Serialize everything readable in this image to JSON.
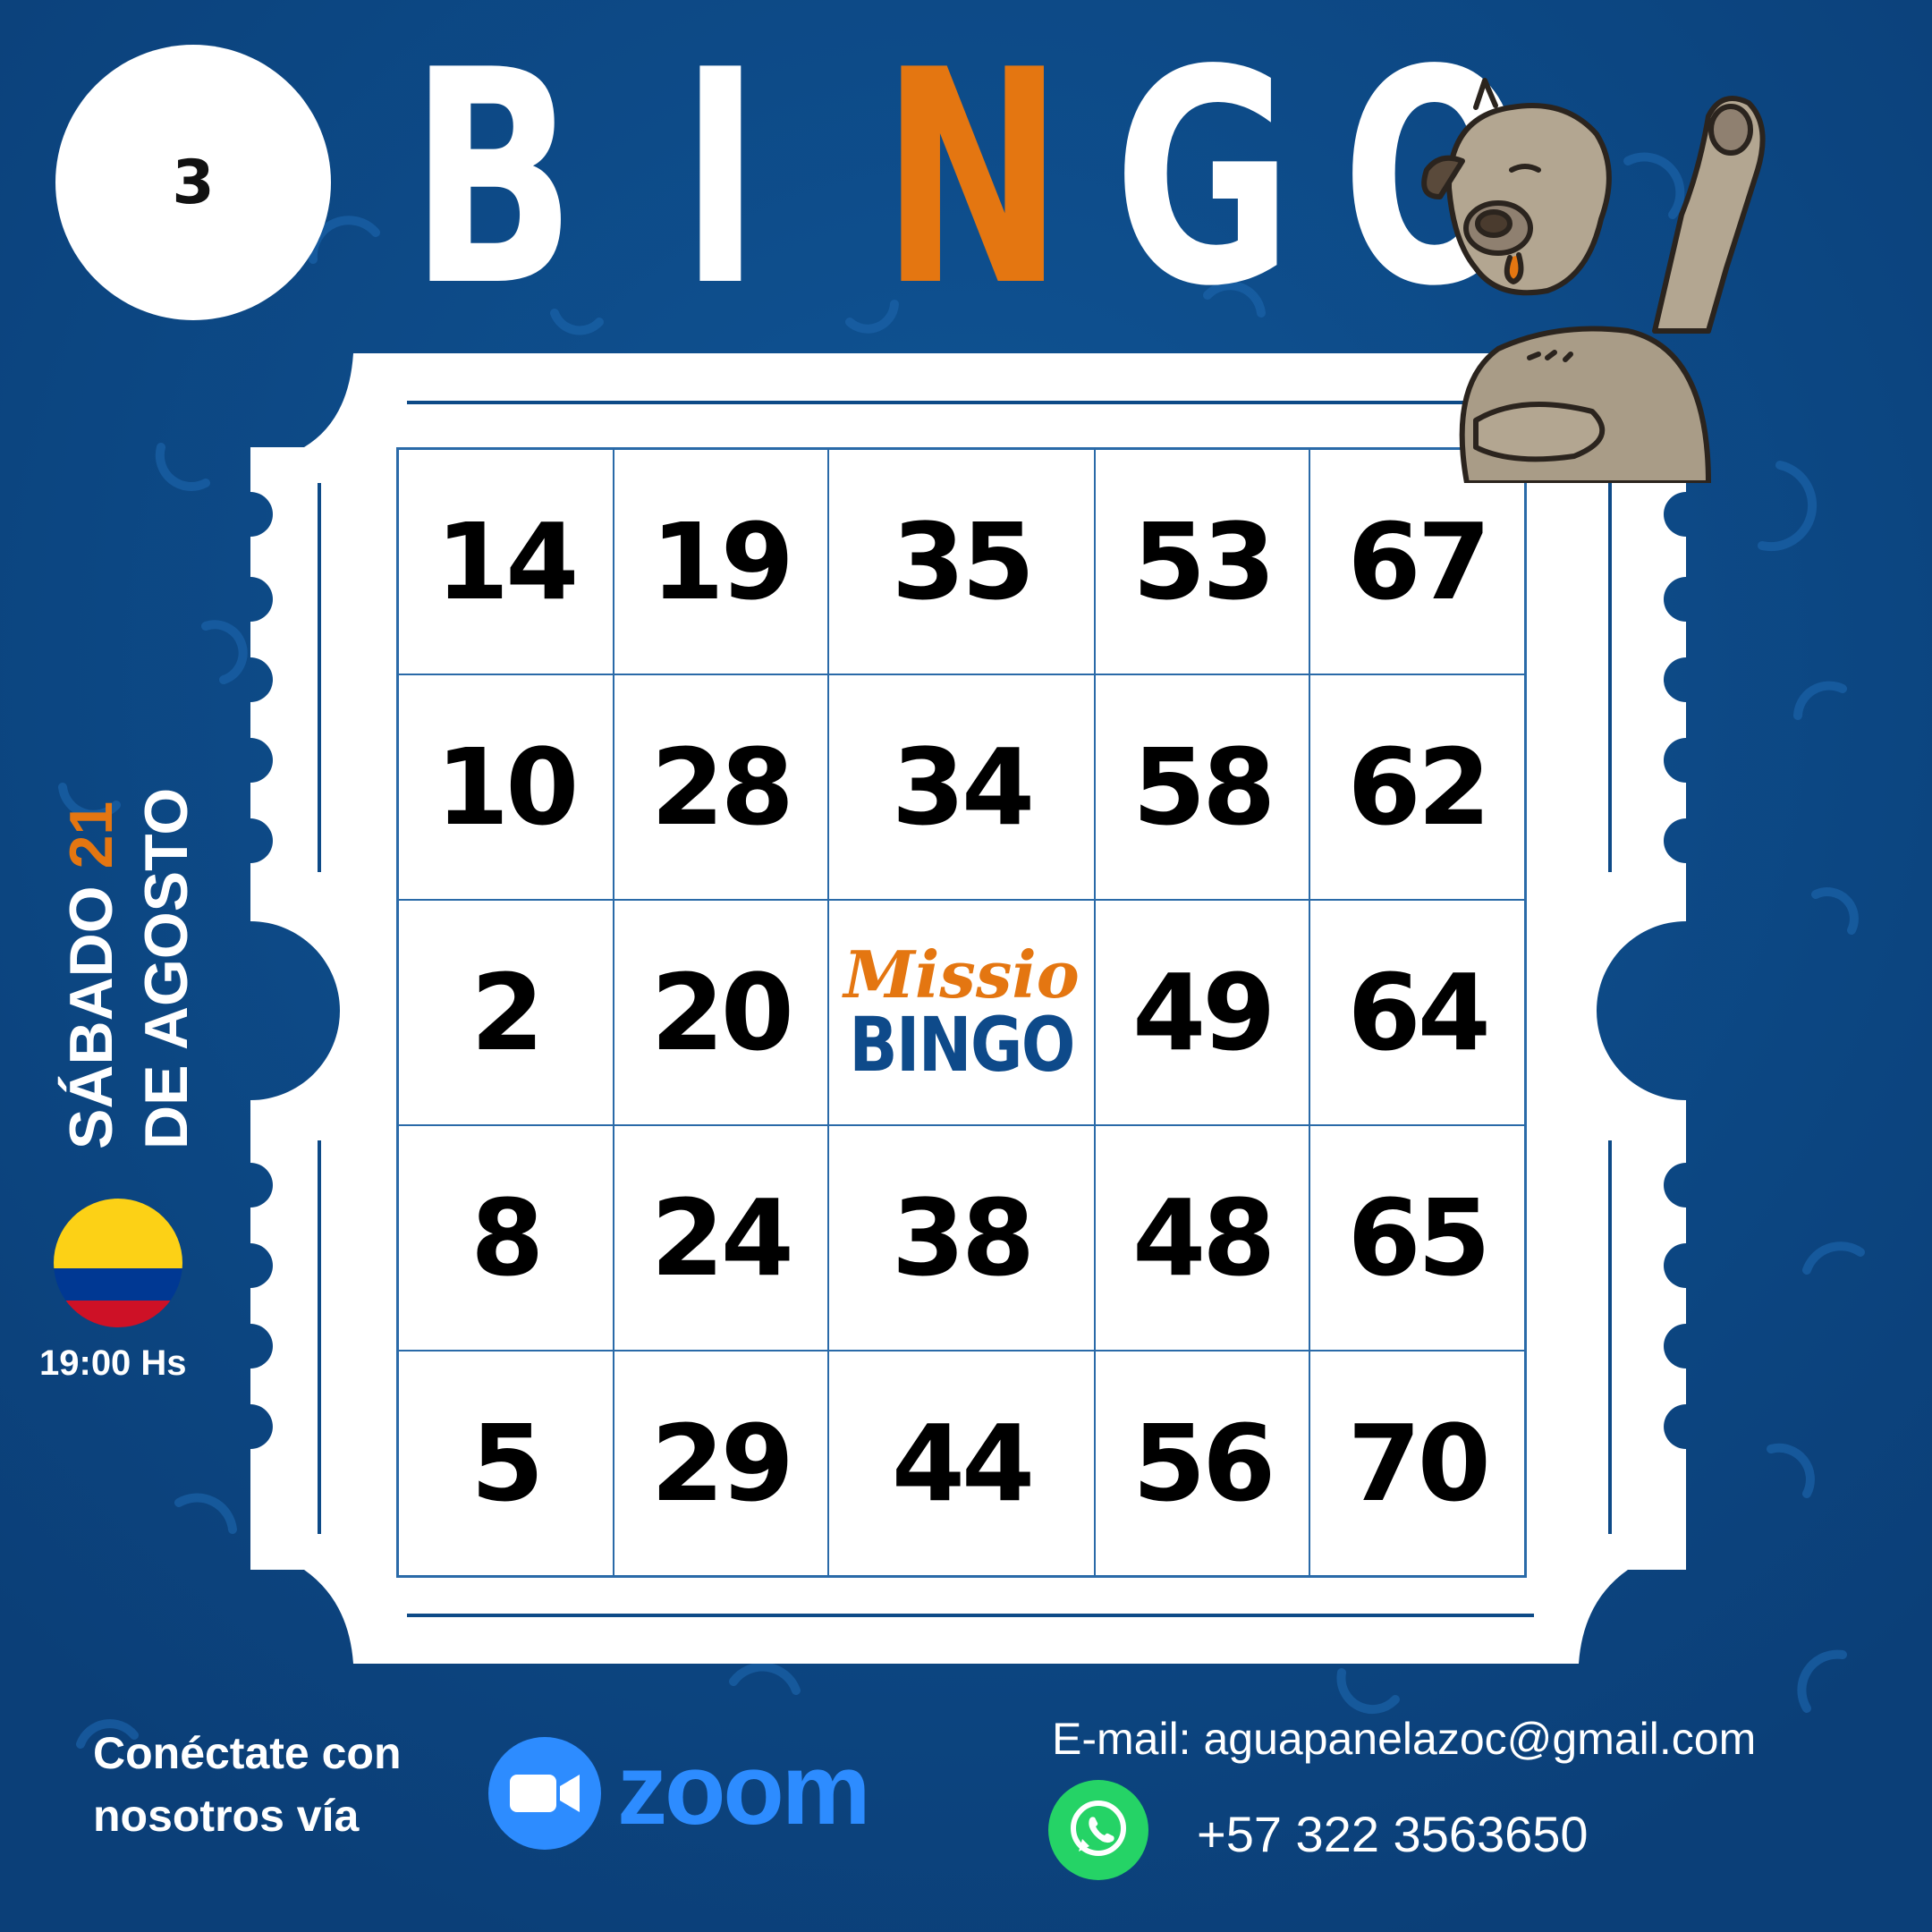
{
  "card_number": "3",
  "title_letters": [
    {
      "char": "B",
      "color": "#ffffff"
    },
    {
      "char": "I",
      "color": "#ffffff"
    },
    {
      "char": "N",
      "color": "#e47611"
    },
    {
      "char": "G",
      "color": "#ffffff"
    },
    {
      "char": "O",
      "color": "#ffffff"
    }
  ],
  "grid": [
    [
      "14",
      "19",
      "35",
      "53",
      "67"
    ],
    [
      "10",
      "28",
      "34",
      "58",
      "62"
    ],
    [
      "2",
      "20",
      "",
      "49",
      "64"
    ],
    [
      "8",
      "24",
      "38",
      "48",
      "65"
    ],
    [
      "5",
      "29",
      "44",
      "56",
      "70"
    ]
  ],
  "free_space": {
    "line1": "Missio",
    "line2": "BINGO"
  },
  "event": {
    "day": "SÁBADO",
    "date_number": "21",
    "month_line": "DE AGOSTO",
    "time": "19:00 Hs"
  },
  "footer": {
    "connect_line1": "Conéctate con",
    "connect_line2": "nosotros vía",
    "zoom_label": "zoom",
    "email": "E-mail: aguapanelazoc@gmail.com",
    "phone": "+57 322 3563650"
  },
  "colors": {
    "background": "#0d4a87",
    "accent": "#e47611",
    "grid_line": "#2a6aa8",
    "zoom": "#2d8cff",
    "whatsapp": "#25d366"
  },
  "icons": [
    "colombia-flag-icon",
    "zoom-icon",
    "whatsapp-icon",
    "bear-mascot"
  ]
}
